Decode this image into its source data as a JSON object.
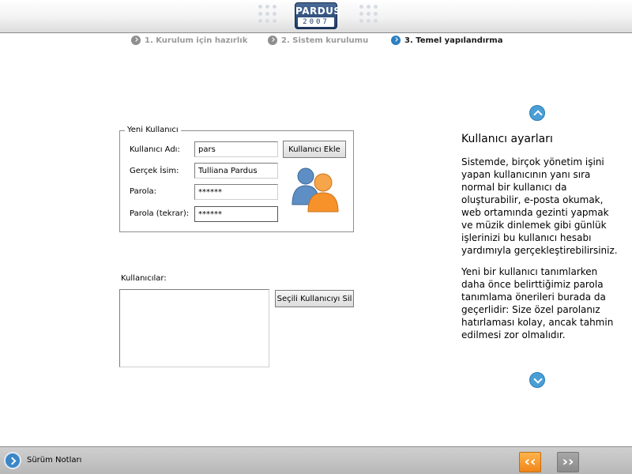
{
  "header": {
    "logo_brand": "PARDUS",
    "logo_year": "2007"
  },
  "steps": [
    {
      "label": "1. Kurulum için hazırlık",
      "state": "inactive"
    },
    {
      "label": "2. Sistem kurulumu",
      "state": "inactive"
    },
    {
      "label": "3. Temel yapılandırma",
      "state": "active"
    }
  ],
  "new_user": {
    "group_title": "Yeni Kullanıcı",
    "username_label": "Kullanıcı Adı:",
    "username_value": "pars",
    "realname_label": "Gerçek İsim:",
    "realname_value": "Tulliana Pardus",
    "password_label": "Parola:",
    "password_value": "******",
    "password_confirm_label": "Parola (tekrar):",
    "password_confirm_value": "******",
    "add_button": "Kullanıcı Ekle"
  },
  "users": {
    "label": "Kullanıcılar:",
    "items": [],
    "delete_button": "Seçili Kullanıcıyı Sil"
  },
  "help": {
    "title": "Kullanıcı ayarları",
    "paragraphs": [
      "Sistemde, birçok yönetim işini yapan kullanıcının yanı sıra normal bir kullanıcı da oluşturabilir, e-posta okumak, web ortamında gezinti yapmak ve müzik dinlemek gibi günlük işlerinizi bu kullanıcı hesabı yardımıyla gerçekleştirebilirsiniz.",
      "Yeni bir kullanıcı tanımlarken daha önce belirttiğimiz parola tanımlama önerileri burada da geçerlidir: Size özel parolanız hatırlaması kolay, ancak tahmin edilmesi zor olmalıdır."
    ]
  },
  "footer": {
    "release_notes": "Sürüm Notları",
    "back_glyph": "‹‹",
    "next_glyph": "››"
  },
  "colors": {
    "accent_blue": "#2b7fc1",
    "back_orange": "#f0851a",
    "next_gray": "#8b8b8b"
  }
}
